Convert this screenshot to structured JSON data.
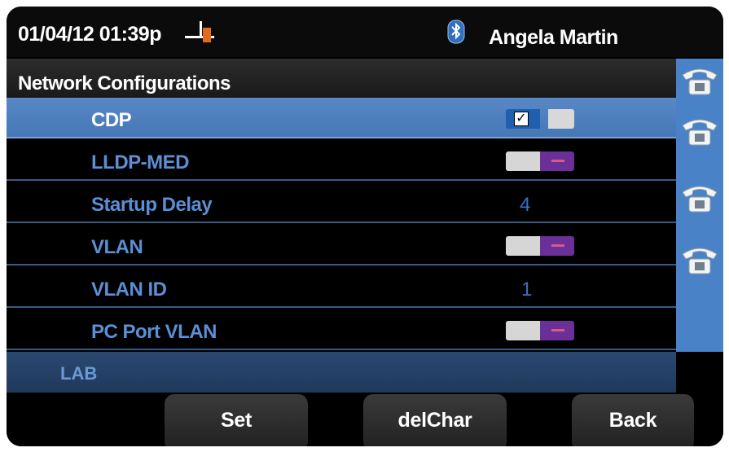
{
  "status_bar": {
    "datetime": "01/04/12 01:39p",
    "user_name": "Angela Martin",
    "icons": [
      "handset-offhook-icon",
      "bluetooth-icon"
    ]
  },
  "page": {
    "title": "Network Configurations"
  },
  "rows": [
    {
      "label": "CDP",
      "control": "toggle",
      "state": "on",
      "selected": true
    },
    {
      "label": "LLDP-MED",
      "control": "toggle",
      "state": "off"
    },
    {
      "label": "Startup Delay",
      "control": "value",
      "value": "4"
    },
    {
      "label": "VLAN",
      "control": "toggle",
      "state": "off"
    },
    {
      "label": "VLAN ID",
      "control": "value",
      "value": "1"
    },
    {
      "label": "PC Port VLAN",
      "control": "toggle",
      "state": "off"
    }
  ],
  "footer_label": "LAB",
  "line_keys": [
    "phone-line-icon",
    "phone-line-icon",
    "phone-line-icon",
    "phone-line-icon"
  ],
  "softkeys": {
    "set": "Set",
    "delchar": "delChar",
    "back": "Back"
  },
  "colors": {
    "selected_row": "#5888c6",
    "row_text": "#5b8fd6",
    "toggle_off": "#6a3098",
    "toggle_on": "#1f5fb0"
  }
}
